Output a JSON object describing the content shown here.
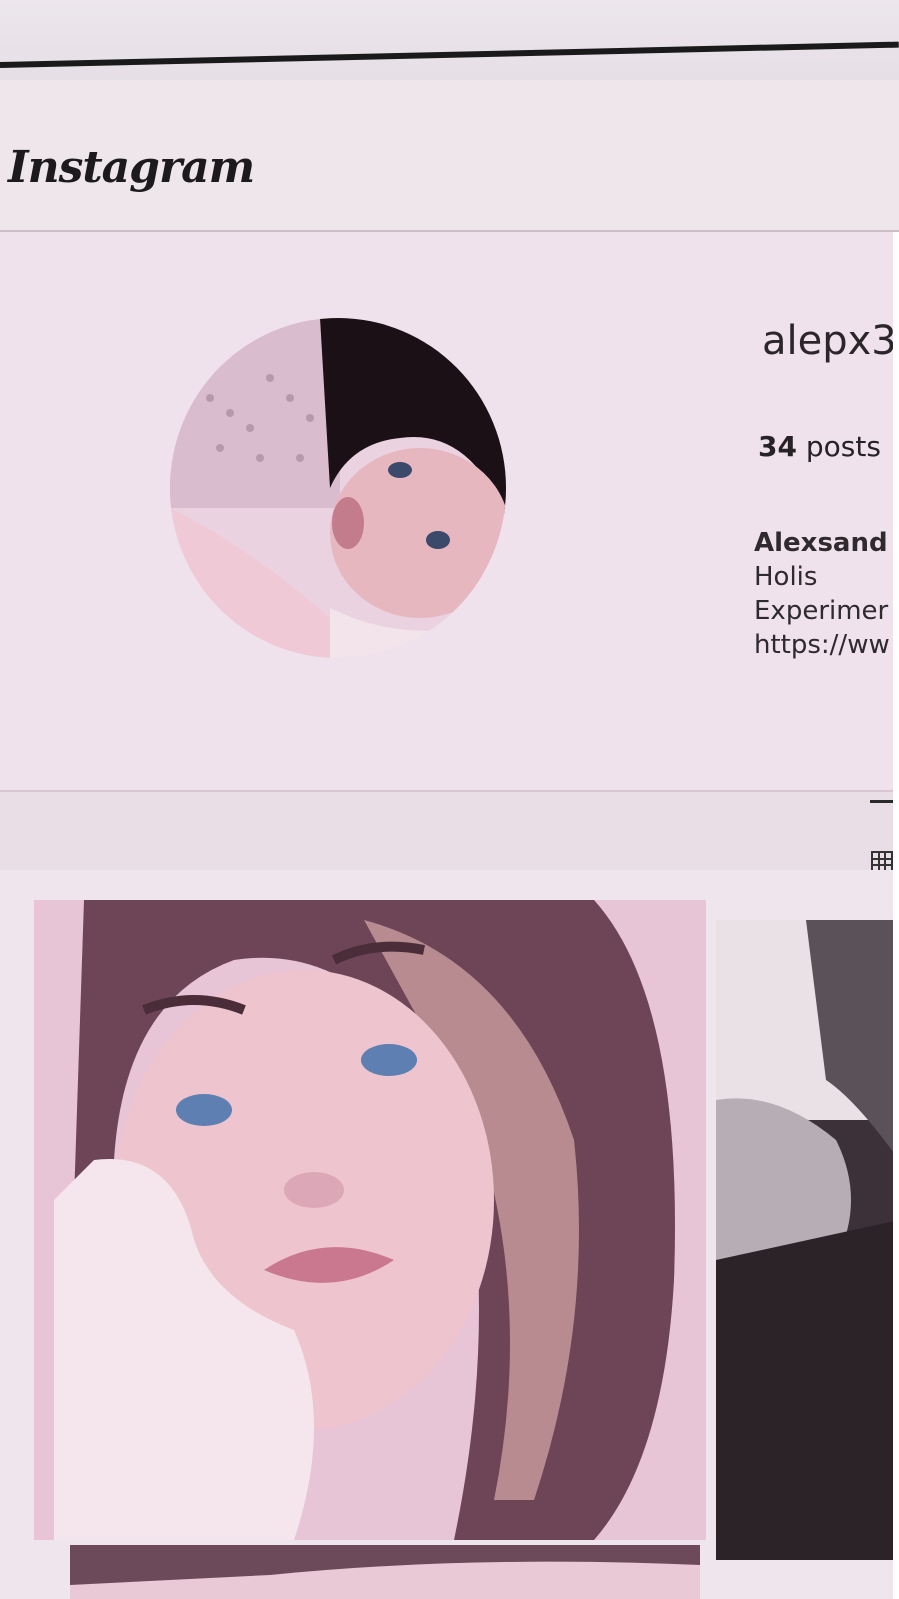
{
  "header": {
    "logo_text": "Instagram"
  },
  "profile": {
    "username": "alepx3",
    "posts_count": "34",
    "posts_label": "posts",
    "bio": {
      "name": "Alexsand",
      "line1": "Holis",
      "line2": "Experimer",
      "link": "https://ww"
    }
  },
  "tabs": {
    "active_icon": "grid-icon"
  },
  "colors": {
    "background": "#f0e2ec",
    "text": "#262226",
    "divider": "#d8c6d2"
  }
}
